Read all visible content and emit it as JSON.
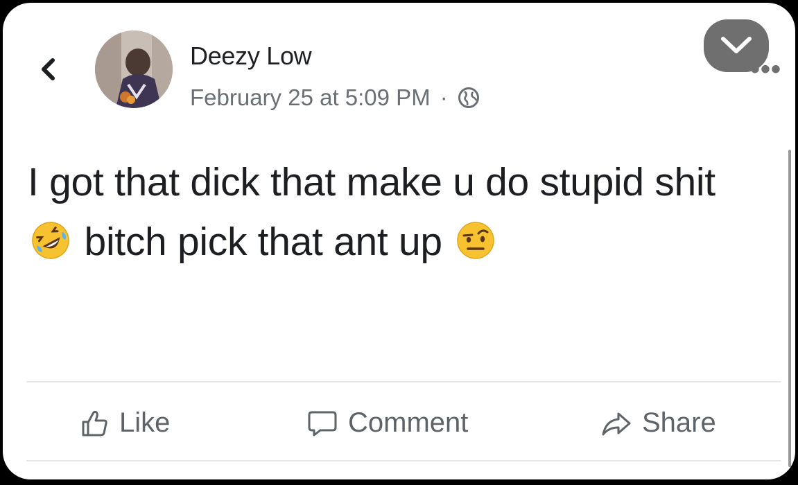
{
  "post": {
    "author": "Deezy Low",
    "timestamp": "February 25 at 5:09 PM",
    "separator": "·",
    "privacy_icon": "globe-icon",
    "text_parts": {
      "p1": "I got that dick that make u do stupid shit",
      "emoji1": "rolling-on-floor-laughing-emoji",
      "p2": "bitch pick that ant up",
      "emoji2": "face-with-raised-eyebrow-emoji"
    }
  },
  "header": {
    "back_icon": "chevron-left-icon",
    "menu_icon": "chevron-down-icon",
    "more_icon": "more-dots-icon",
    "more_text": "•••"
  },
  "actions": {
    "like_label": "Like",
    "comment_label": "Comment",
    "share_label": "Share"
  },
  "colors": {
    "background": "#000000",
    "card": "#ffffff",
    "text": "#1c1e21",
    "secondary_text": "#6a6f75",
    "action_text": "#5e6368",
    "menu_button": "#6f6f6f"
  }
}
